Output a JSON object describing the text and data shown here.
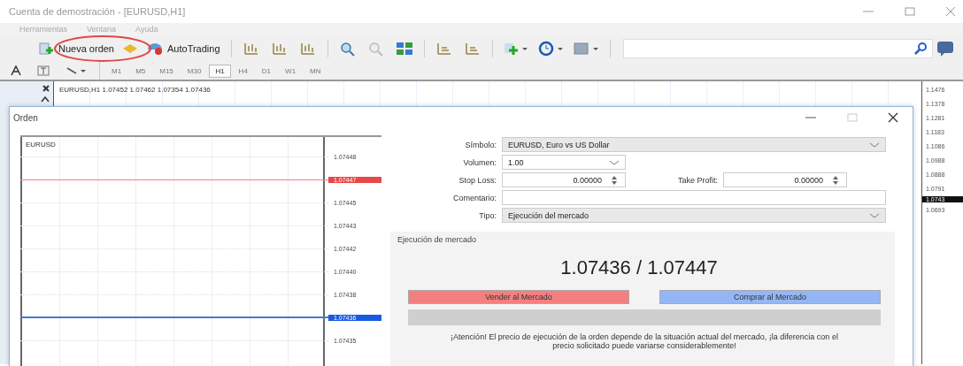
{
  "window": {
    "title": "Cuenta de demostración - [EURUSD,H1]"
  },
  "menu": [
    "Herramientas",
    "Ventana",
    "Ayuda"
  ],
  "toolbar": {
    "new_order": "Nueva orden",
    "autotrading": "AutoTrading"
  },
  "timeframes": [
    {
      "label": "M1",
      "selected": false
    },
    {
      "label": "M5",
      "selected": false
    },
    {
      "label": "M15",
      "selected": false
    },
    {
      "label": "M30",
      "selected": false
    },
    {
      "label": "H1",
      "selected": true
    },
    {
      "label": "H4",
      "selected": false
    },
    {
      "label": "D1",
      "selected": false
    },
    {
      "label": "W1",
      "selected": false
    },
    {
      "label": "MN",
      "selected": false
    }
  ],
  "chart": {
    "header": "EURUSD,H1 1.07452 1.07462 1.07354 1.07436",
    "price_labels": [
      {
        "text": "1.1476",
        "current": false
      },
      {
        "text": "1.1378",
        "current": false
      },
      {
        "text": "1.1281",
        "current": false
      },
      {
        "text": "1.1183",
        "current": false
      },
      {
        "text": "1.1086",
        "current": false
      },
      {
        "text": "1.0988",
        "current": false
      },
      {
        "text": "1.0888",
        "current": false
      },
      {
        "text": "1.0791",
        "current": false
      },
      {
        "text": "1.0743",
        "current": true
      },
      {
        "text": "1.0693",
        "current": false
      }
    ]
  },
  "dialog": {
    "title": "Orden",
    "tick_chart": {
      "symbol": "EURUSD",
      "price_labels": [
        {
          "text": "1.07448",
          "kind": "plain"
        },
        {
          "text": "1.07447",
          "kind": "ask"
        },
        {
          "text": "1.07445",
          "kind": "plain"
        },
        {
          "text": "1.07443",
          "kind": "plain"
        },
        {
          "text": "1.07442",
          "kind": "plain"
        },
        {
          "text": "1.07440",
          "kind": "plain"
        },
        {
          "text": "1.07438",
          "kind": "plain"
        },
        {
          "text": "1.07436",
          "kind": "bid"
        },
        {
          "text": "1.07435",
          "kind": "plain"
        }
      ]
    },
    "form": {
      "symbol_label": "Símbolo:",
      "symbol": "EURUSD, Euro vs US Dollar",
      "volume_label": "Volumen:",
      "volume": "1.00",
      "stop_loss_label": "Stop Loss:",
      "stop_loss": "0.00000",
      "take_profit_label": "Take Profit:",
      "take_profit": "0.00000",
      "comment_label": "Comentario:",
      "type_label": "Tipo:",
      "type": "Ejecución del mercado"
    },
    "market": {
      "title": "Ejecución de mercado",
      "prices": "1.07436 / 1.07447",
      "sell": "Vender al Mercado",
      "buy": "Comprar al Mercado",
      "warning": "¡Atención! El precio de ejecución de la orden depende de la situación actual del mercado, ¡la diferencia con el precio solicitado puede variarse considerablemente!"
    }
  }
}
